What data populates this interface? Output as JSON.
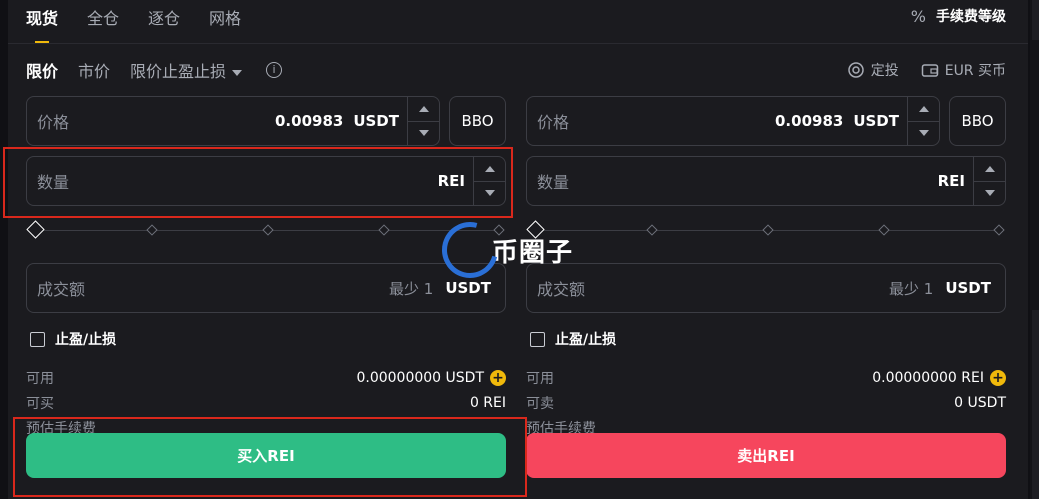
{
  "tabs": [
    "现货",
    "全仓",
    "逐仓",
    "网格"
  ],
  "fee_level": {
    "icon": "percent-icon",
    "label": "手续费等级"
  },
  "order_types": {
    "limit": "限价",
    "market": "市价",
    "stop_limit": "限价止盈止损"
  },
  "links": {
    "recurring": "定投",
    "eur_buy": "EUR 买币"
  },
  "buy": {
    "price_label": "价格",
    "price_value": "0.00983",
    "price_unit": "USDT",
    "bbo_label": "BBO",
    "qty_label": "数量",
    "qty_unit": "REI",
    "amount_label": "成交额",
    "amount_hint": "最少 1",
    "amount_unit": "USDT",
    "tpsl_label": "止盈/止损",
    "available_label": "可用",
    "available_value": "0.00000000 USDT",
    "max_label": "可买",
    "max_value": "0 REI",
    "fee_label": "预估手续费",
    "button_label": "买入REI"
  },
  "sell": {
    "price_label": "价格",
    "price_value": "0.00983",
    "price_unit": "USDT",
    "bbo_label": "BBO",
    "qty_label": "数量",
    "qty_unit": "REI",
    "amount_label": "成交额",
    "amount_hint": "最少 1",
    "amount_unit": "USDT",
    "tpsl_label": "止盈/止损",
    "available_label": "可用",
    "available_value": "0.00000000 REI",
    "max_label": "可卖",
    "max_value": "0 USDT",
    "fee_label": "预估手续费",
    "button_label": "卖出REI"
  },
  "watermark": {
    "text": "币圈子"
  },
  "colors": {
    "buy": "#2ebd85",
    "sell": "#f6465d",
    "accent": "#f0b90b",
    "highlight_box": "#d9281c"
  }
}
